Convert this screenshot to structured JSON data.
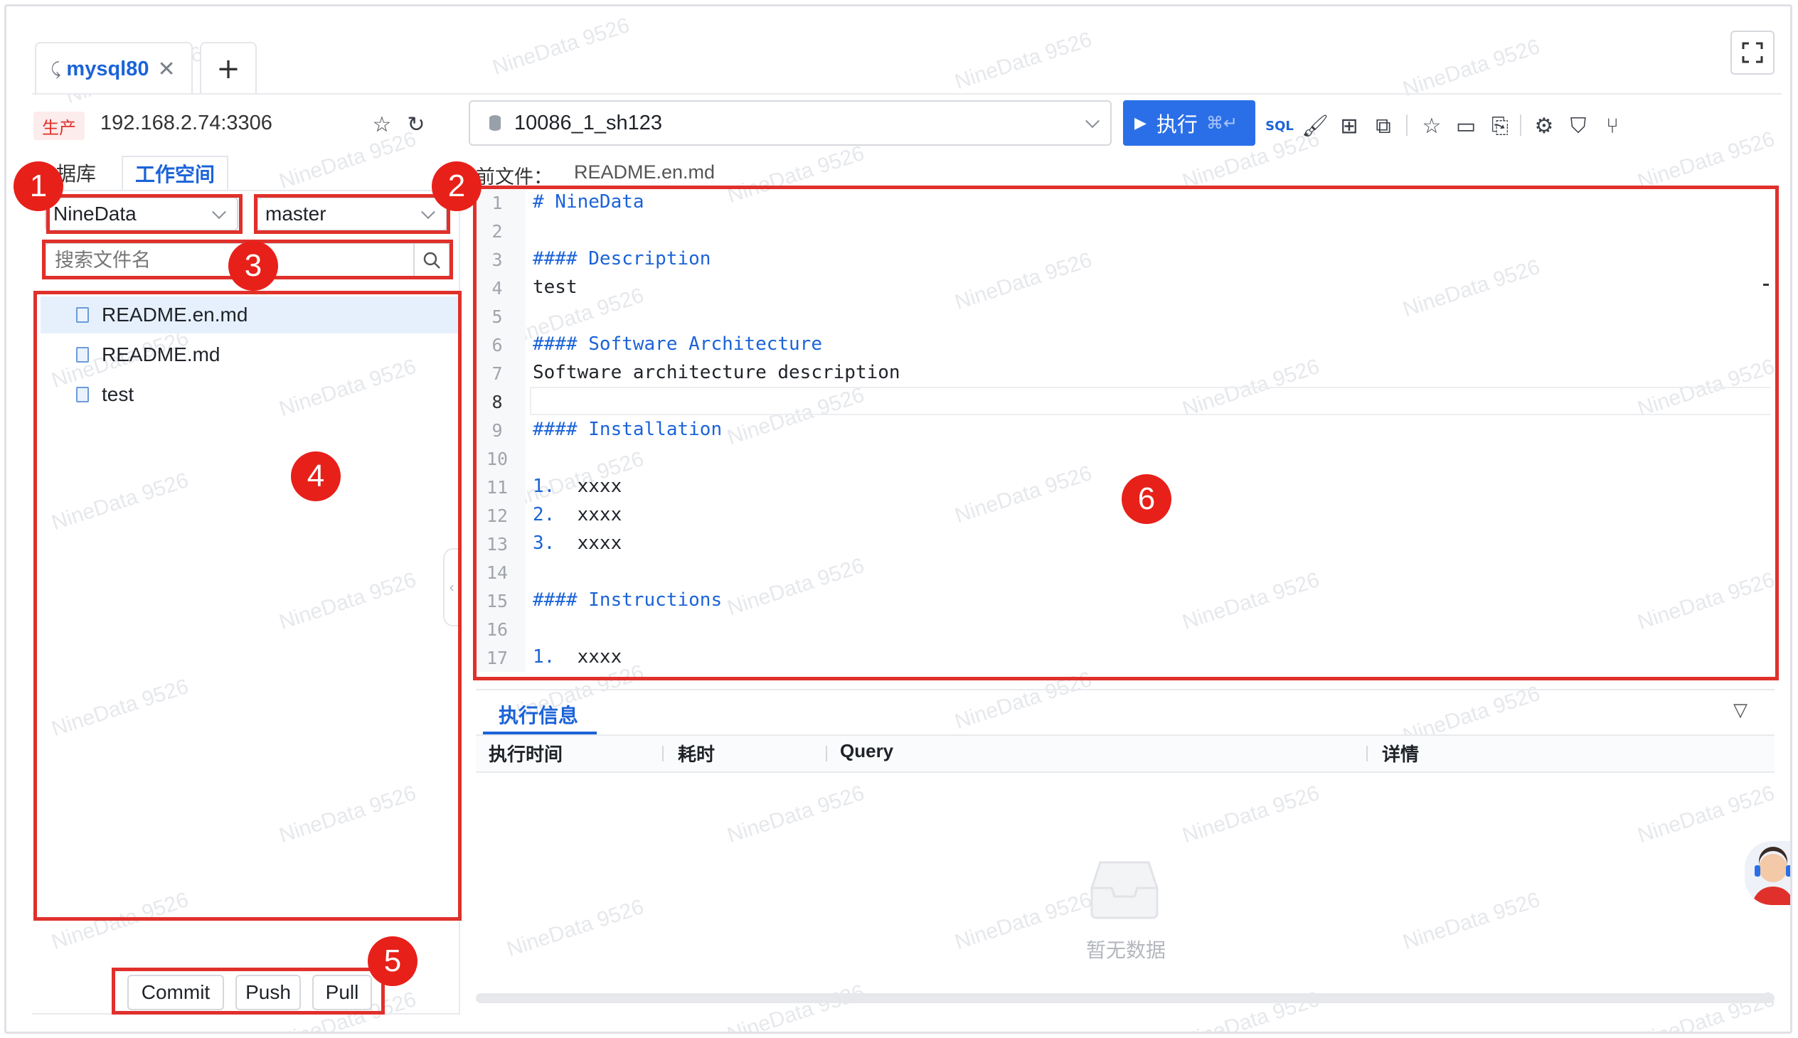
{
  "tabs": {
    "active": "mysql80",
    "add": "+"
  },
  "connection": {
    "env_badge": "生产",
    "host": "192.168.2.74:3306"
  },
  "left_tabs": {
    "database": "数据库",
    "database_visible": "据库",
    "workspace": "工作空间"
  },
  "repo_select": {
    "value": "NineData"
  },
  "branch_select": {
    "value": "master"
  },
  "search": {
    "placeholder": "搜索文件名"
  },
  "files": [
    {
      "name": "README.en.md",
      "selected": true
    },
    {
      "name": "README.md"
    },
    {
      "name": "test"
    }
  ],
  "git": {
    "commit": "Commit",
    "push": "Push",
    "pull": "Pull"
  },
  "db_select": {
    "value": "10086_1_sh123"
  },
  "run": {
    "label": "执行",
    "shortcut": "⌘↵"
  },
  "toolbar_icons": [
    "sql-format-icon",
    "paint-icon",
    "tree-icon",
    "chart-icon",
    "star-icon",
    "folder-icon",
    "file-settings-icon",
    "gear-icon",
    "shield-icon",
    "branch-icon"
  ],
  "current_file": {
    "label": "当前文件：",
    "label_visible": "前文件：",
    "name": "README.en.md"
  },
  "editor_lines": [
    {
      "n": "1",
      "text": "# NineData",
      "kw": true
    },
    {
      "n": "2",
      "text": ""
    },
    {
      "n": "3",
      "text": "#### Description",
      "kw": true
    },
    {
      "n": "4",
      "text": "test"
    },
    {
      "n": "5",
      "text": ""
    },
    {
      "n": "6",
      "text": "#### Software Architecture",
      "kw": true
    },
    {
      "n": "7",
      "text": "Software architecture description"
    },
    {
      "n": "8",
      "text": ""
    },
    {
      "n": "9",
      "text": "#### Installation",
      "kw": true
    },
    {
      "n": "10",
      "text": ""
    },
    {
      "n": "11",
      "prefix": "1.",
      "text": "  xxxx"
    },
    {
      "n": "12",
      "prefix": "2.",
      "text": "  xxxx"
    },
    {
      "n": "13",
      "prefix": "3.",
      "text": "  xxxx"
    },
    {
      "n": "14",
      "text": ""
    },
    {
      "n": "15",
      "text": "#### Instructions",
      "kw": true
    },
    {
      "n": "16",
      "text": ""
    },
    {
      "n": "17",
      "prefix": "1.",
      "text": "  xxxx"
    }
  ],
  "result": {
    "tab": "执行信息",
    "columns": [
      "执行时间",
      "耗时",
      "Query",
      "详情"
    ],
    "empty": "暂无数据"
  },
  "annotations": [
    "1",
    "2",
    "3",
    "4",
    "5",
    "6"
  ],
  "watermark": "NineData 9526"
}
